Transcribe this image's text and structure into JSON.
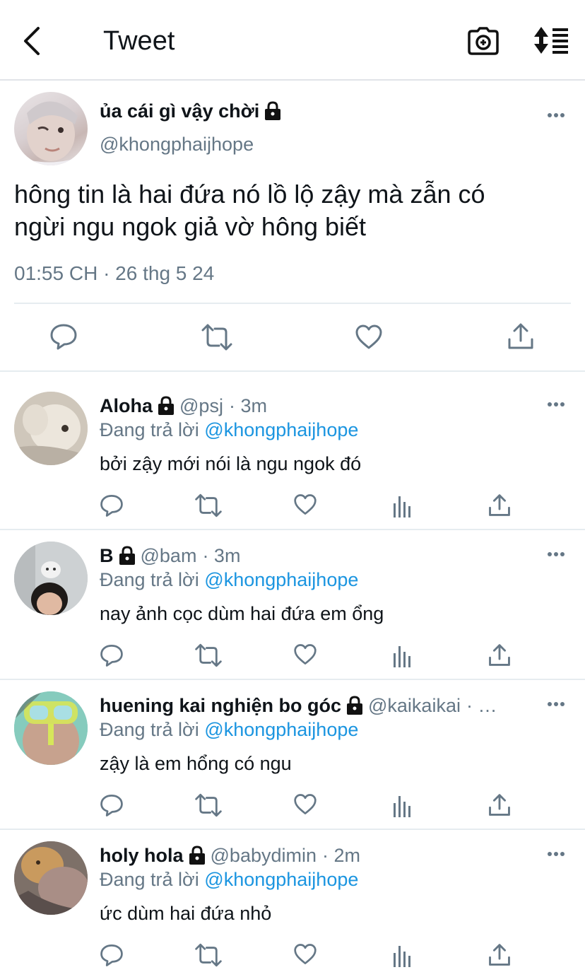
{
  "header": {
    "title": "Tweet",
    "back_icon": "back-arrow-icon",
    "camera_icon": "camera-icon",
    "sort_icon": "sort-icon"
  },
  "main_tweet": {
    "display_name": "ủa cái gì vậy chời",
    "handle": "@khongphaijhope",
    "text_line1": "hông tin là hai đứa nó lồ lộ zậy mà zẫn có",
    "text_line2": "ngừi ngu ngok giả vờ hông biết",
    "timestamp": "01:55 CH · 26 thg 5 24"
  },
  "replies": [
    {
      "name": "Aloha",
      "handle": "@psj",
      "time": "· 3m",
      "replying_prefix": "Đang trả lời",
      "replying_to": "@khongphaijhope",
      "text": "bởi zậy mới nói là ngu ngok đó"
    },
    {
      "name": "B",
      "handle": "@bam",
      "time": "· 3m",
      "replying_prefix": "Đang trả lời",
      "replying_to": "@khongphaijhope",
      "text": "nay ảnh cọc dùm hai đứa em ổng"
    },
    {
      "name": "huening kai nghiện bo góc",
      "handle": "@kaikaikai",
      "time": "· …",
      "replying_prefix": "Đang trả lời",
      "replying_to": "@khongphaijhope",
      "text": "zậy là em hổng có ngu"
    },
    {
      "name": "holy hola",
      "handle": "@babydimin",
      "time": "· 2m",
      "replying_prefix": "Đang trả lời",
      "replying_to": "@khongphaijhope",
      "text": "ức dùm hai đứa nhỏ"
    }
  ],
  "colors": {
    "link": "#1b95e0",
    "muted": "#657786",
    "divider": "#e6ecf0"
  }
}
